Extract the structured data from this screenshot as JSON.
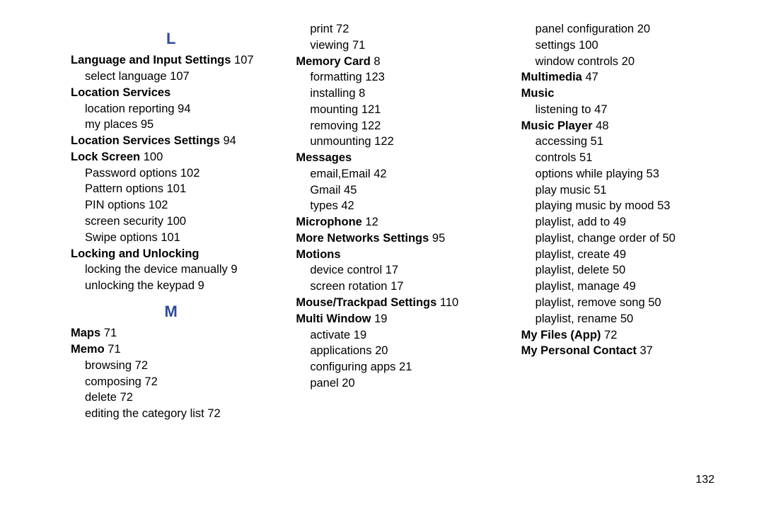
{
  "page_number": "132",
  "letters": {
    "L": "L",
    "M": "M"
  },
  "col1": {
    "lang_input": "Language and Input Settings",
    "lang_input_pg": "107",
    "lang_input_sub1": "select language",
    "lang_input_sub1_pg": "107",
    "loc_services": "Location Services",
    "loc_services_sub1": "location reporting",
    "loc_services_sub1_pg": "94",
    "loc_services_sub2": "my places",
    "loc_services_sub2_pg": "95",
    "loc_services_settings": "Location Services Settings",
    "loc_services_settings_pg": "94",
    "lock_screen": "Lock Screen",
    "lock_screen_pg": "100",
    "lock_screen_sub1": "Password options",
    "lock_screen_sub1_pg": "102",
    "lock_screen_sub2": "Pattern options",
    "lock_screen_sub2_pg": "101",
    "lock_screen_sub3": "PIN options",
    "lock_screen_sub3_pg": "102",
    "lock_screen_sub4": "screen security",
    "lock_screen_sub4_pg": "100",
    "lock_screen_sub5": "Swipe options",
    "lock_screen_sub5_pg": "101",
    "locking": "Locking and Unlocking",
    "locking_sub1": "locking the device manually",
    "locking_sub1_pg": "9",
    "locking_sub2": "unlocking the keypad",
    "locking_sub2_pg": "9",
    "maps": "Maps",
    "maps_pg": "71",
    "memo": "Memo",
    "memo_pg": "71",
    "memo_sub1": "browsing",
    "memo_sub1_pg": "72",
    "memo_sub2": "composing",
    "memo_sub2_pg": "72",
    "memo_sub3": "delete",
    "memo_sub3_pg": "72",
    "memo_sub4": "editing the category list",
    "memo_sub4_pg": "72"
  },
  "col2": {
    "print": "print",
    "print_pg": "72",
    "viewing": "viewing",
    "viewing_pg": "71",
    "memory_card": "Memory Card",
    "memory_card_pg": "8",
    "mc_sub1": "formatting",
    "mc_sub1_pg": "123",
    "mc_sub2": "installing",
    "mc_sub2_pg": "8",
    "mc_sub3": "mounting",
    "mc_sub3_pg": "121",
    "mc_sub4": "removing",
    "mc_sub4_pg": "122",
    "mc_sub5": "unmounting",
    "mc_sub5_pg": "122",
    "messages": "Messages",
    "msg_sub1": "email,Email",
    "msg_sub1_pg": "42",
    "msg_sub2": "Gmail",
    "msg_sub2_pg": "45",
    "msg_sub3": "types",
    "msg_sub3_pg": "42",
    "microphone": "Microphone",
    "microphone_pg": "12",
    "more_networks": "More Networks Settings",
    "more_networks_pg": "95",
    "motions": "Motions",
    "motions_sub1": "device control",
    "motions_sub1_pg": "17",
    "motions_sub2": "screen rotation",
    "motions_sub2_pg": "17",
    "mouse": "Mouse/Trackpad Settings",
    "mouse_pg": "110",
    "multi_window": "Multi Window",
    "multi_window_pg": "19",
    "mw_sub1": "activate",
    "mw_sub1_pg": "19",
    "mw_sub2": "applications",
    "mw_sub2_pg": "20",
    "mw_sub3": "configuring apps",
    "mw_sub3_pg": "21",
    "mw_sub4": "panel",
    "mw_sub4_pg": "20"
  },
  "col3": {
    "panel_config": "panel configuration",
    "panel_config_pg": "20",
    "settings": "settings",
    "settings_pg": "100",
    "window_controls": "window controls",
    "window_controls_pg": "20",
    "multimedia": "Multimedia",
    "multimedia_pg": "47",
    "music": "Music",
    "music_sub1": "listening to",
    "music_sub1_pg": "47",
    "music_player": "Music Player",
    "music_player_pg": "48",
    "mp_sub1": "accessing",
    "mp_sub1_pg": "51",
    "mp_sub2": "controls",
    "mp_sub2_pg": "51",
    "mp_sub3": "options while playing",
    "mp_sub3_pg": "53",
    "mp_sub4": "play music",
    "mp_sub4_pg": "51",
    "mp_sub5": "playing music by mood",
    "mp_sub5_pg": "53",
    "mp_sub6": "playlist, add to",
    "mp_sub6_pg": "49",
    "mp_sub7": "playlist, change order of",
    "mp_sub7_pg": "50",
    "mp_sub8": "playlist, create",
    "mp_sub8_pg": "49",
    "mp_sub9": "playlist, delete",
    "mp_sub9_pg": "50",
    "mp_sub10": "playlist, manage",
    "mp_sub10_pg": "49",
    "mp_sub11": "playlist, remove song",
    "mp_sub11_pg": "50",
    "mp_sub12": "playlist, rename",
    "mp_sub12_pg": "50",
    "my_files": "My Files (App)",
    "my_files_pg": "72",
    "my_contact": "My Personal Contact",
    "my_contact_pg": "37"
  }
}
